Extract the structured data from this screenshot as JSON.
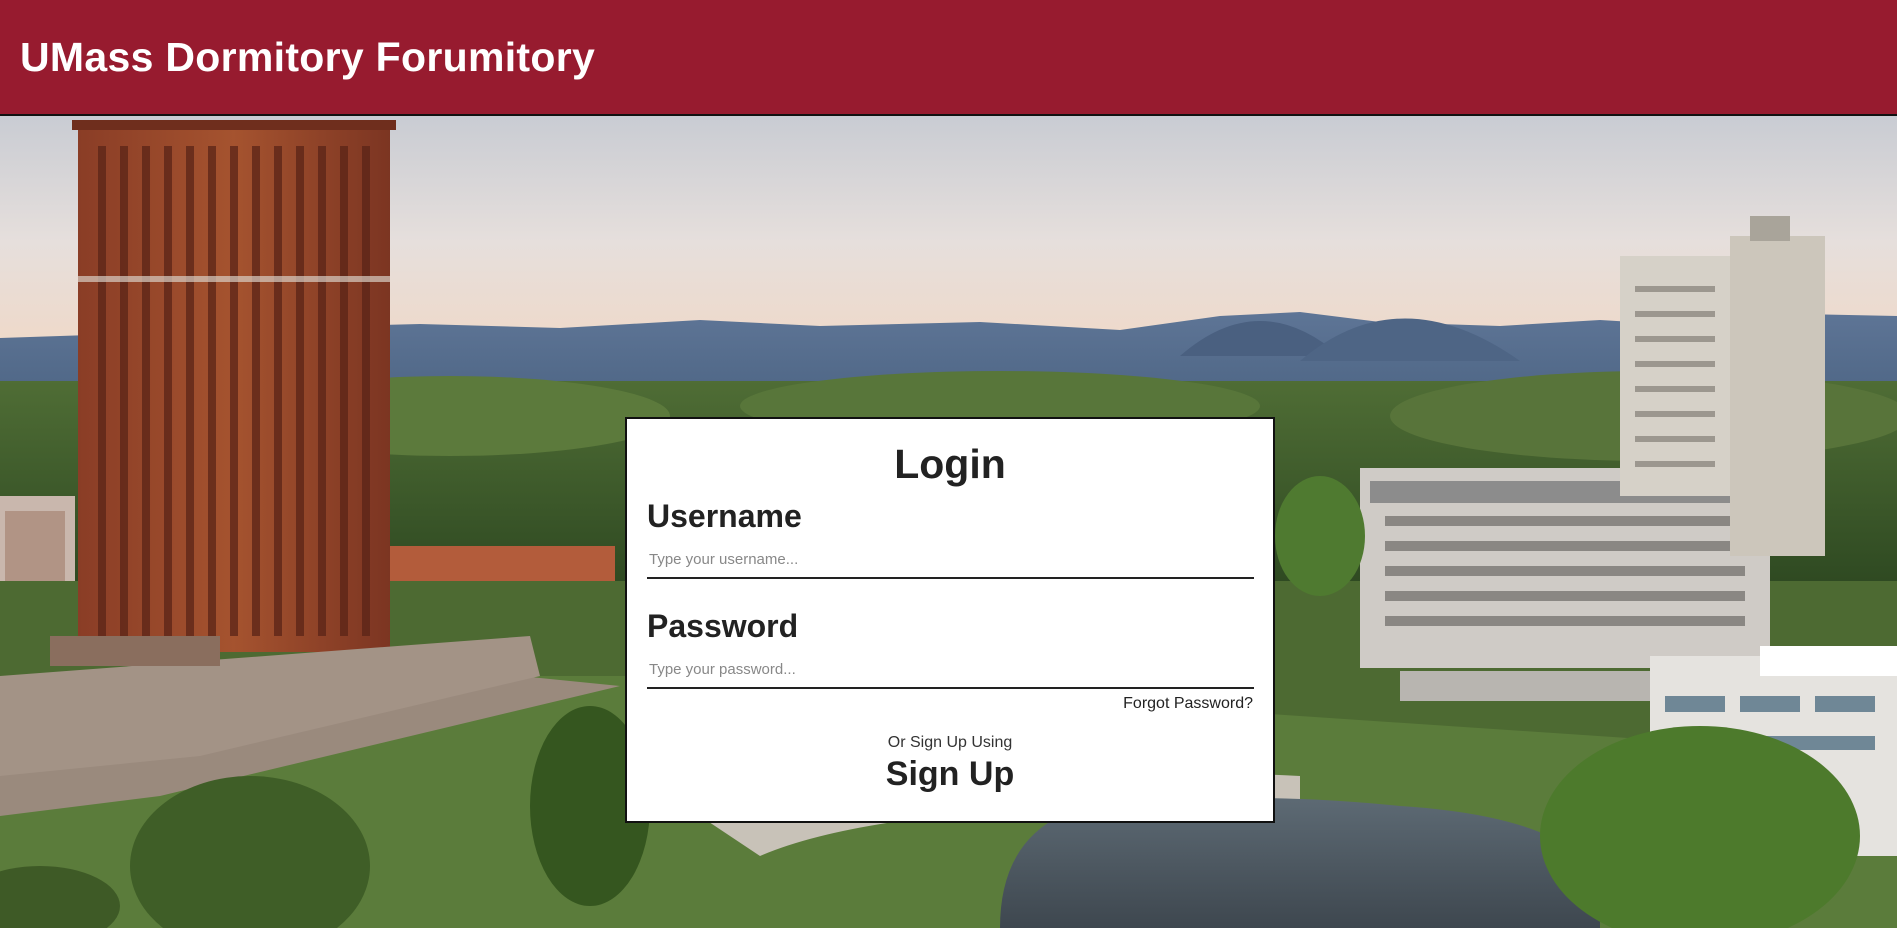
{
  "header": {
    "title": "UMass Dormitory Forumitory",
    "background_color": "#971b2f"
  },
  "background": {
    "description_icon": "campus-photo"
  },
  "login": {
    "title": "Login",
    "username_label": "Username",
    "username_placeholder": "Type your username...",
    "username_value": "",
    "password_label": "Password",
    "password_placeholder": "Type your password...",
    "password_value": "",
    "forgot_password": "Forgot Password?",
    "or_text": "Or Sign Up Using",
    "signup_label": "Sign Up"
  }
}
